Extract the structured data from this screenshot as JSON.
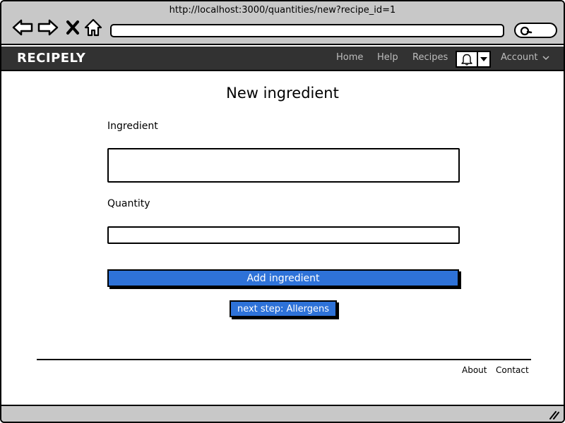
{
  "browser": {
    "url": "http://localhost:3000/quantities/new?recipe_id=1",
    "icons": [
      "back-arrow-icon",
      "forward-arrow-icon",
      "close-x-icon",
      "home-icon",
      "search-icon"
    ]
  },
  "navbar": {
    "brand": "RECIPELY",
    "links": [
      "Home",
      "Help",
      "Recipes"
    ],
    "account_label": "Account",
    "icons": [
      "bell-icon",
      "caret-down-icon",
      "chevron-down-icon"
    ]
  },
  "form": {
    "title": "New ingredient",
    "ingredient_label": "Ingredient",
    "ingredient_value": "",
    "quantity_label": "Quantity",
    "quantity_value": "",
    "submit_label": "Add ingredient",
    "next_step_label": "next step: Allergens"
  },
  "footer": {
    "links": [
      "About",
      "Contact"
    ]
  },
  "colors": {
    "chrome": "#c8c8c8",
    "navbar": "#323232",
    "button": "#2e72d8"
  }
}
